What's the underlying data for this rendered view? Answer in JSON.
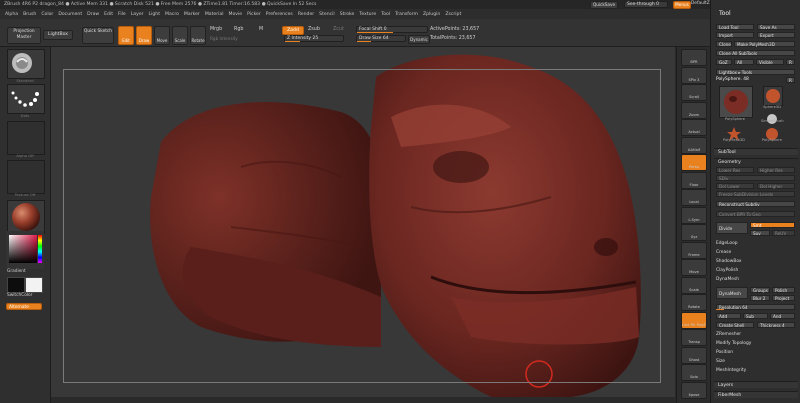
{
  "titlebar": {
    "text": "ZBrush 4R6 P2   dragon_84   ● Active Mem 331  ● Scratch Disk 521  ● Free Mem 2576  ● ZTime1.81  Timer:16.583  ● QuickSave In 52 Secs",
    "quicksave": "QuickSave",
    "seethrough": "See-through 0",
    "menus": "Menus",
    "defaultscript": "DefaultZScript"
  },
  "menubar": [
    "Alpha",
    "Brush",
    "Color",
    "Document",
    "Draw",
    "Edit",
    "File",
    "Layer",
    "Light",
    "Macro",
    "Marker",
    "Material",
    "Movie",
    "Picker",
    "Preferences",
    "Render",
    "Stencil",
    "Stroke",
    "Texture",
    "Tool",
    "Transform",
    "Zplugin",
    "Zscript"
  ],
  "toolbar": {
    "projection_master": "Projection Master",
    "lightbox": "LightBox",
    "quick_sketch": "Quick Sketch",
    "edit": "Edit",
    "draw": "Draw",
    "move": "Move",
    "scale": "Scale",
    "rotate": "Rotate",
    "mrgb": "Mrgb",
    "rgb": "Rgb",
    "m": "M",
    "rgb_intensity": "Rgb Intensity",
    "zadd": "Zadd",
    "zsub": "Zsub",
    "zcut": "Zcut",
    "z_intensity": "Z Intensity 25",
    "focal_shift": "Focal Shift 0",
    "draw_size": "Draw Size 64",
    "dynamic": "Dynamic",
    "active_points": "ActivePoints: 23,657",
    "total_points": "TotalPoints: 23,657"
  },
  "leftshelf": {
    "brush_label": "Standard",
    "stroke_label": "Dots",
    "alpha_label": "Alpha Off",
    "texture_label": "Texture Off",
    "material_label": "SkinShade4",
    "gradient": "Gradient",
    "switchcolor": "SwitchColor",
    "alternate": "Alternate"
  },
  "rightshelf": [
    "BPR",
    "SPix 3",
    "Scroll",
    "Zoom",
    "Actual",
    "AAHalf",
    "Persp",
    "Floor",
    "Local",
    "L.Sym",
    "Xyz",
    "Frame",
    "Move",
    "Scale",
    "Rotate",
    "Line Fill PolyF",
    "Transp",
    "Ghost",
    "Solo",
    "Xpose"
  ],
  "toolpanel": {
    "title": "Tool",
    "load_tool": "Load Tool",
    "save_as": "Save As",
    "import": "Import",
    "export": "Export",
    "clone": "Clone",
    "make_polymesh": "Make PolyMesh3D",
    "clone_all": "Clone All SubTools",
    "goz": "GoZ",
    "all": "All",
    "visible": "Visible",
    "r": "R",
    "lightbox_tools": "Lightbox ▸ Tools",
    "polysphere": "PolySphere. 48",
    "r2": "R",
    "thumbs": [
      "PolySphere",
      "Sphere3D",
      "SimpleBrush",
      "PolyMesh3D",
      "PolySphere"
    ],
    "subtool": "SubTool",
    "geometry": "Geometry",
    "lower_res": "Lower Res",
    "higher_res": "Higher Res",
    "sdiv": "SDiv",
    "del_lower": "Del Lower",
    "del_higher": "Del Higher",
    "freeze": "Freeze SubDivision Levels",
    "reconstruct": "Reconstruct Subdiv",
    "convert_bpr": "Convert BPR To Geo",
    "divide": "Divide",
    "smt": "Smt",
    "suv": "Suv",
    "reuv": "ReUV",
    "edgeloop": "EdgeLoop",
    "crease": "Crease",
    "shadowbox": "ShadowBox",
    "claypolish": "ClayPolish",
    "dynamesh": "DynaMesh",
    "dynamesh2": "DynaMesh",
    "groups": "Groups",
    "polish": "Polish",
    "blur": "Blur 2",
    "project": "Project",
    "resolution": "Resolution 64",
    "add": "Add",
    "sub": "Sub",
    "and": "And",
    "create_shell": "Create Shell",
    "thickness": "Thickness 4",
    "zremesher": "ZRemesher",
    "modify_topology": "Modify Topology",
    "position": "Position",
    "size": "Size",
    "meshintegrity": "MeshIntegrity",
    "layers": "Layers",
    "fibermesh": "FiberMesh"
  },
  "colors": {
    "accent": "#e8811e",
    "model": "#6b2520"
  }
}
